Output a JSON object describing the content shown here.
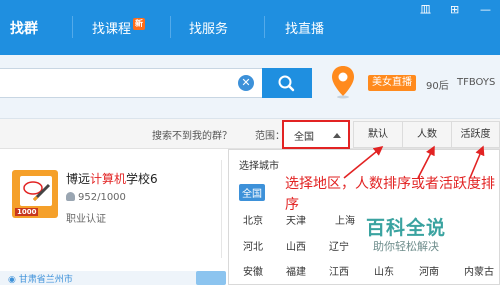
{
  "nav": {
    "items": [
      "找群",
      "找课程",
      "找服务",
      "找直播"
    ],
    "new_badge": "新",
    "window_controls": [
      "皿",
      "⊞",
      "—"
    ]
  },
  "search": {
    "value": "",
    "clear_glyph": "✕",
    "live_badge": "美女直播",
    "tags": [
      "90后",
      "TFBOYS"
    ]
  },
  "filter": {
    "not_found_text": "搜索不到我的群？",
    "range_label": "范围：",
    "range_value": "全国",
    "sort_options": [
      "默认",
      "人数",
      "活跃度"
    ]
  },
  "group_card": {
    "title_before": "博远",
    "title_highlight": "计算机",
    "title_after": "学校6",
    "members": "952/1000",
    "certification": "职业认证",
    "location": "甘肃省兰州市",
    "icon_tag": "1000"
  },
  "city_panel": {
    "title": "选择城市",
    "all_label": "全国",
    "rows": [
      [
        "北京",
        "天津",
        "上海"
      ],
      [
        "河北",
        "山西",
        "辽宁"
      ],
      [
        "安徽",
        "福建",
        "江西",
        "山东",
        "河南",
        "内蒙古"
      ]
    ]
  },
  "annotation": "选择地区，人数排序或者活跃度排序",
  "watermark": {
    "title": "百科全说",
    "subtitle": "助你轻松解决"
  },
  "colors": {
    "brand_blue": "#1f8fe0",
    "annotation_red": "#e22323",
    "live_orange": "#ff8a1d",
    "watermark_teal": "#3aa3a0"
  }
}
